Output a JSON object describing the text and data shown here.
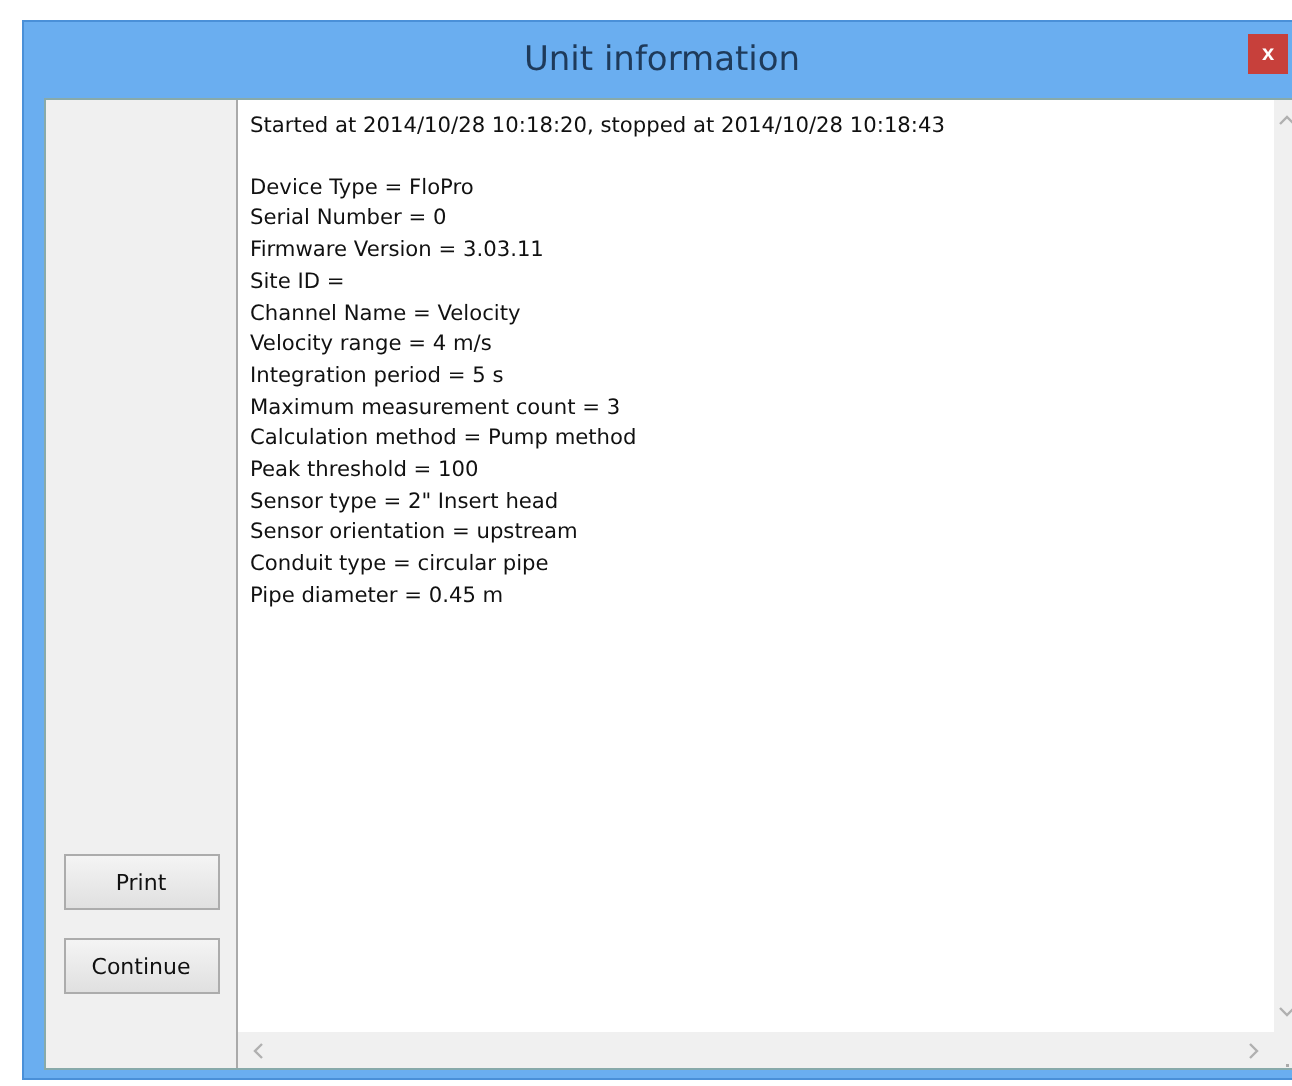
{
  "window": {
    "title": "Unit information",
    "close": "x"
  },
  "buttons": [
    "Print",
    "Continue"
  ],
  "log": {
    "header": "Started at 2014/10/28 10:18:20, stopped at 2014/10/28 10:18:43",
    "lines": [
      "Device Type = FloPro",
      "Serial Number = 0",
      "Firmware Version = 3.03.11",
      "Site ID =",
      "Channel Name = Velocity",
      "Velocity range = 4 m/s",
      "Integration period = 5 s",
      "Maximum measurement count = 3",
      "Calculation method = Pump method",
      "Peak threshold = 100",
      "Sensor type = 2\" Insert head",
      "Sensor orientation = upstream",
      "Conduit type = circular pipe",
      "Pipe diameter = 0.45 m"
    ]
  }
}
